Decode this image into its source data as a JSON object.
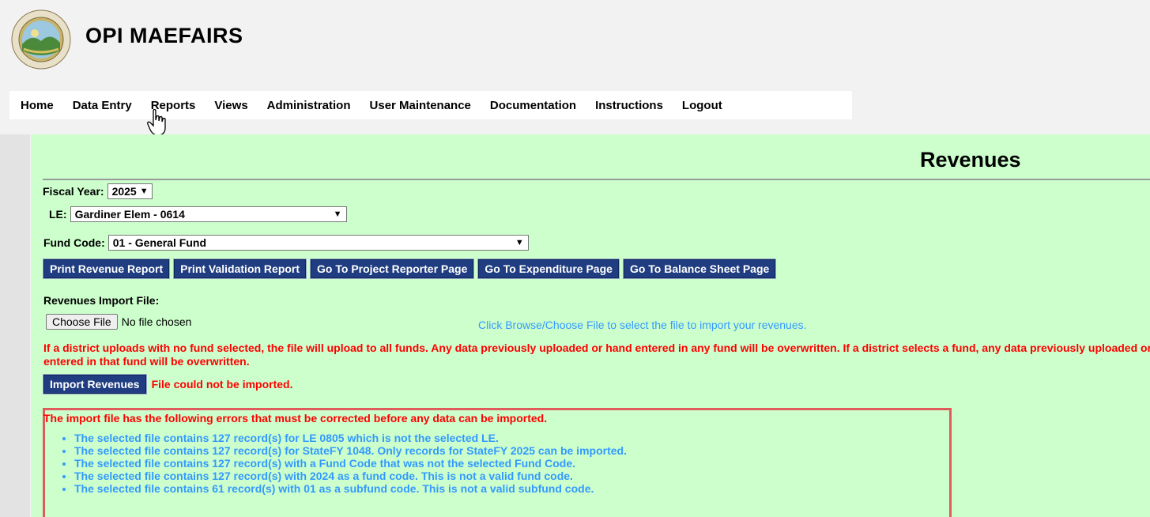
{
  "app": {
    "title": "OPI  MAEFAIRS"
  },
  "nav": [
    {
      "name": "nav-home",
      "label": "Home"
    },
    {
      "name": "nav-data-entry",
      "label": "Data Entry"
    },
    {
      "name": "nav-reports",
      "label": "Reports"
    },
    {
      "name": "nav-views",
      "label": "Views"
    },
    {
      "name": "nav-administration",
      "label": "Administration"
    },
    {
      "name": "nav-user-maintenance",
      "label": "User Maintenance"
    },
    {
      "name": "nav-documentation",
      "label": "Documentation"
    },
    {
      "name": "nav-instructions",
      "label": "Instructions"
    },
    {
      "name": "nav-logout",
      "label": "Logout"
    }
  ],
  "page": {
    "title": "Revenues"
  },
  "filters": {
    "fiscal_year_label": "Fiscal Year:",
    "fiscal_year_value": "2025",
    "le_label": "LE:",
    "le_value": "Gardiner Elem - 0614",
    "fund_code_label": "Fund Code:",
    "fund_code_value": "01 - General Fund"
  },
  "buttons": [
    {
      "name": "print-revenue-report-button",
      "label": "Print Revenue Report"
    },
    {
      "name": "print-validation-report-button",
      "label": "Print Validation Report"
    },
    {
      "name": "go-to-project-reporter-button",
      "label": "Go To Project Reporter Page"
    },
    {
      "name": "go-to-expenditure-button",
      "label": "Go To Expenditure Page"
    },
    {
      "name": "go-to-balance-sheet-button",
      "label": "Go To Balance Sheet Page"
    }
  ],
  "import": {
    "label": "Revenues Import File:",
    "choose_file": "Choose File",
    "no_file": "No file chosen",
    "hint": "Click Browse/Choose File to select the file to import your revenues.",
    "warning": "If a district uploads with no fund selected, the file will upload to all funds. Any data previously uploaded or hand entered in any fund will be overwritten. If a district selects a fund, any data previously uploaded or hand entered in that fund will be overwritten.",
    "button": "Import Revenues",
    "error": "File could not be imported."
  },
  "errors": {
    "heading": "The import file has the following errors that must be corrected before any data can be imported.",
    "items": [
      "The selected file contains 127 record(s) for LE 0805 which is not the selected LE.",
      "The selected file contains 127 record(s) for StateFY 1048. Only records for StateFY 2025 can be imported.",
      "The selected file contains 127 record(s) with a Fund Code that was not the selected Fund Code.",
      "The selected file contains 127 record(s) with 2024 as a fund code. This is not a valid fund code.",
      "The selected file contains 61 record(s) with 01 as a subfund code. This is not a valid subfund code."
    ]
  },
  "colors": {
    "panel": "#ccffcc",
    "button": "#1f3d80",
    "error": "#ff0000",
    "info": "#3399ff"
  }
}
